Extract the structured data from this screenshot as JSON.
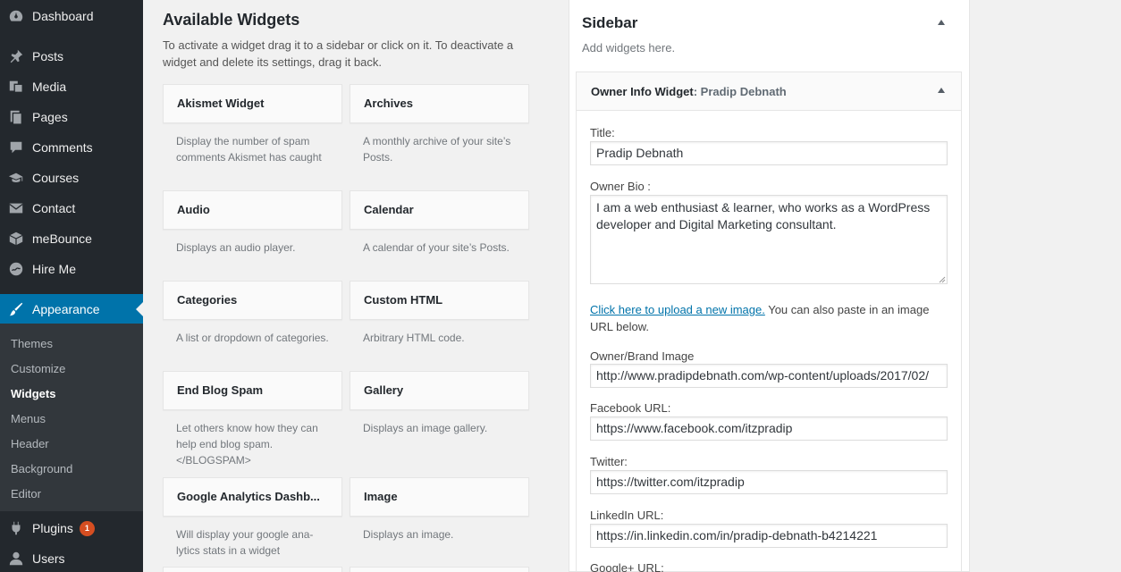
{
  "admin_menu": {
    "items": [
      {
        "label": "Dashboard",
        "icon": "dashboard-icon"
      },
      {
        "label": "Posts",
        "icon": "pin-icon"
      },
      {
        "label": "Media",
        "icon": "media-icon"
      },
      {
        "label": "Pages",
        "icon": "pages-icon"
      },
      {
        "label": "Comments",
        "icon": "comment-icon"
      },
      {
        "label": "Courses",
        "icon": "graduation-cap-icon"
      },
      {
        "label": "Contact",
        "icon": "envelope-icon"
      },
      {
        "label": "meBounce",
        "icon": "box-icon"
      },
      {
        "label": "Hire Me",
        "icon": "hire-me-icon"
      },
      {
        "label": "Appearance",
        "icon": "brush-icon"
      },
      {
        "label": "Plugins",
        "icon": "plug-icon",
        "badge": "1"
      },
      {
        "label": "Users",
        "icon": "user-icon"
      }
    ],
    "appearance_submenu": [
      "Themes",
      "Customize",
      "Widgets",
      "Menus",
      "Header",
      "Background",
      "Editor"
    ],
    "current_submenu": "Widgets"
  },
  "available_widgets": {
    "title": "Available Widgets",
    "description": "To activate a widget drag it to a sidebar or click on it. To deactivate a widget and delete its settings, drag it back.",
    "widgets": [
      {
        "name": "Akismet Widget",
        "description": "Display the number of spam comments Akismet has caught"
      },
      {
        "name": "Archives",
        "description": "A monthly archive of your site’s Posts."
      },
      {
        "name": "Audio",
        "description": "Displays an audio player."
      },
      {
        "name": "Calendar",
        "description": "A calendar of your site’s Posts."
      },
      {
        "name": "Categories",
        "description": "A list or dropdown of categories."
      },
      {
        "name": "Custom HTML",
        "description": "Arbitrary HTML code."
      },
      {
        "name": "End Blog Spam",
        "description": "Let others know how they can help end blog spam. </BLOGSPAM>"
      },
      {
        "name": "Gallery",
        "description": "Displays an image gallery."
      },
      {
        "name": "Google Analytics Dashb...",
        "description": "Will display your google ana-lytics stats in a widget"
      },
      {
        "name": "Image",
        "description": "Displays an image."
      }
    ]
  },
  "sidebar": {
    "title": "Sidebar",
    "description": "Add widgets here.",
    "widget": {
      "name": "Owner Info Widget",
      "title_suffix": ": Pradip Debnath",
      "fields": {
        "title_label": "Title:",
        "title_value": "Pradip Debnath",
        "bio_label": "Owner Bio :",
        "bio_value": "I am a web enthusiast & learner, who works as a WordPress developer and Digital Marketing consultant.",
        "upload_link": "Click here to upload a new image.",
        "upload_note": " You can also paste in an image URL below.",
        "image_label": "Owner/Brand Image",
        "image_value": "http://www.pradipdebnath.com/wp-content/uploads/2017/02/",
        "facebook_label": "Facebook URL:",
        "facebook_value": "https://www.facebook.com/itzpradip",
        "twitter_label": "Twitter:",
        "twitter_value": "https://twitter.com/itzpradip",
        "linkedin_label": "LinkedIn URL:",
        "linkedin_value": "https://in.linkedin.com/in/pradip-debnath-b4214221",
        "googleplus_label": "Google+ URL:"
      }
    }
  },
  "colors": {
    "admin_bg": "#23282d",
    "submenu_bg": "#32373c",
    "accent": "#0073aa",
    "badge": "#d54e21"
  }
}
